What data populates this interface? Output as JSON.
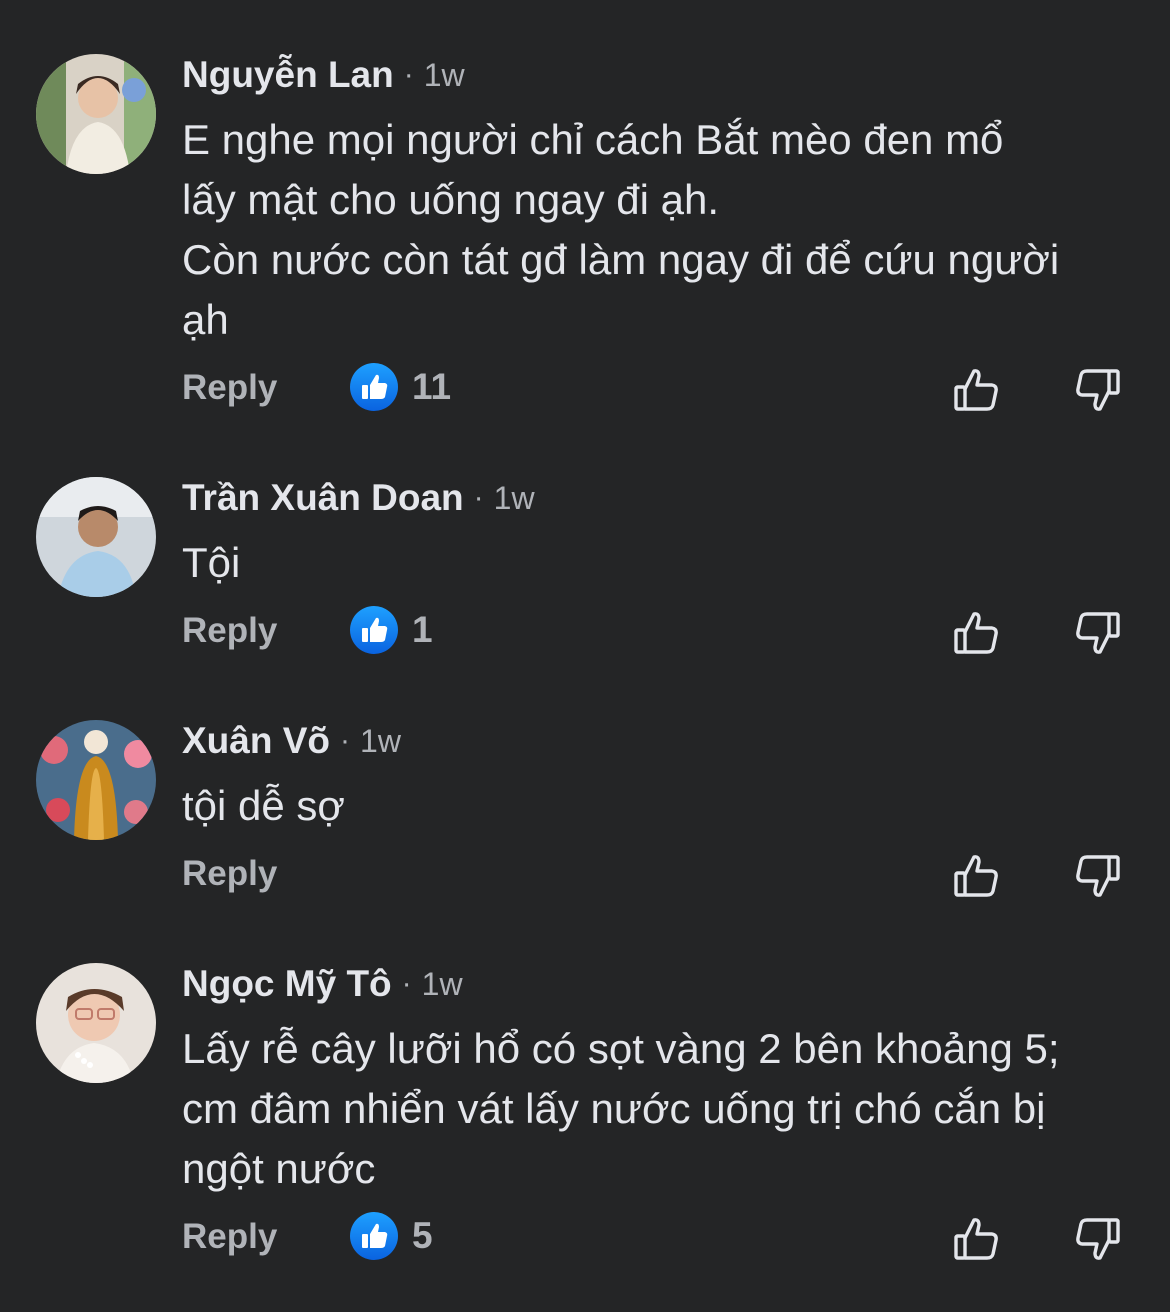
{
  "theme": {
    "background": "#242526",
    "text": "#e4e6eb",
    "muted": "#b0b3b8",
    "like_blue": "#1877f2"
  },
  "comments": [
    {
      "author": "Nguyễn Lan",
      "separator": "·",
      "time": "1w",
      "text": "E nghe mọi người chỉ cách Bắt mèo đen mổ\nlấy mật cho uống ngay đi ạh.\nCòn nước còn tát gđ làm ngay đi để cứu người\nạh",
      "reply_label": "Reply",
      "like_count": "11",
      "reaction_icon": "like-thumb-icon"
    },
    {
      "author": "Trần Xuân Doan",
      "separator": "·",
      "time": "1w",
      "text": "Tội",
      "reply_label": "Reply",
      "like_count": "1",
      "reaction_icon": "like-thumb-icon"
    },
    {
      "author": "Xuân Võ",
      "separator": "·",
      "time": "1w",
      "text": "tội dễ sợ",
      "reply_label": "Reply",
      "reaction_icon": ""
    },
    {
      "author": "Ngọc Mỹ Tô",
      "separator": "·",
      "time": "1w",
      "text": "Lấy rễ cây lưỡi hổ có sọt vàng 2 bên khoảng 5;\ncm đâm nhiển vát lấy nước uống trị chó cắn bị\nngột nước",
      "reply_label": "Reply",
      "like_count": "5",
      "reaction_icon": "like-thumb-icon"
    }
  ]
}
